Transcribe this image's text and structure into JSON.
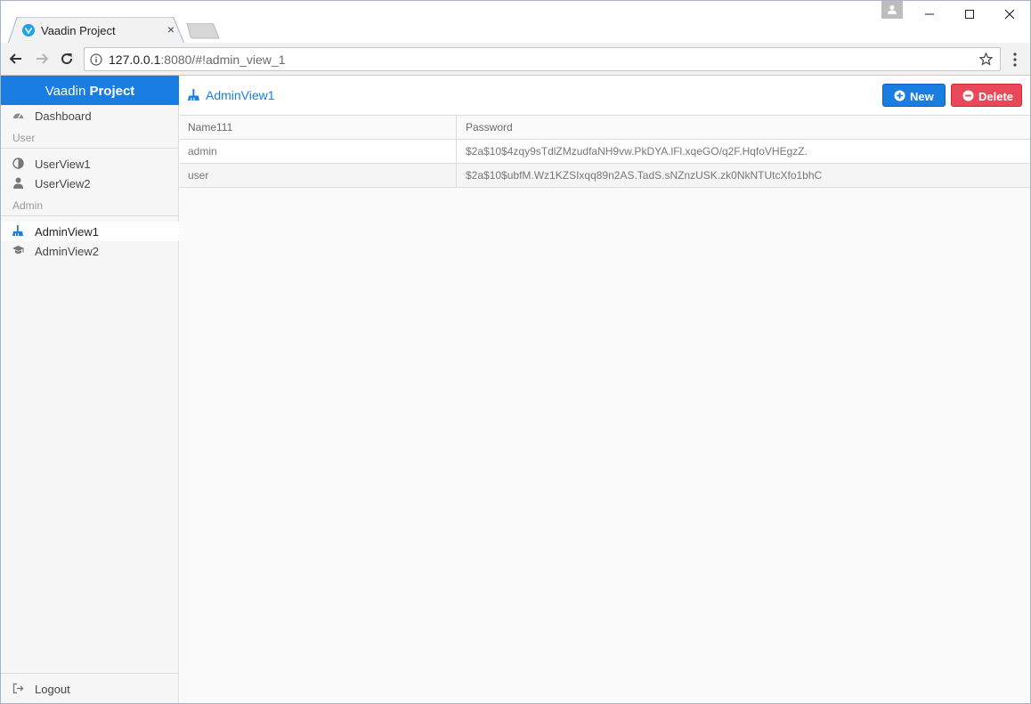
{
  "browser": {
    "tab_title": "Vaadin Project",
    "tab_close": "×",
    "url_host": "127.0.0.1",
    "url_rest": ":8080/#!admin_view_1"
  },
  "sidebar": {
    "brand_light": "Vaadin",
    "brand_bold": "Project",
    "items": [
      {
        "label": "Dashboard",
        "icon": "dashboard-icon"
      },
      {
        "label": "UserView1",
        "icon": "adjust-icon"
      },
      {
        "label": "UserView2",
        "icon": "user-icon"
      },
      {
        "label": "AdminView1",
        "icon": "broom-icon",
        "active": true
      },
      {
        "label": "AdminView2",
        "icon": "graduation-cap-icon"
      }
    ],
    "sections": [
      "User",
      "Admin"
    ],
    "logout_label": "Logout"
  },
  "view": {
    "title": "AdminView1",
    "new_label": "New",
    "delete_label": "Delete"
  },
  "grid": {
    "columns": [
      "Name111",
      "Password"
    ],
    "rows": [
      [
        "admin",
        "$2a$10$4zqy9sTdlZMzudfaNH9vw.PkDYA.lFl.xqeGO/q2F.HqfoVHEgzZ."
      ],
      [
        "user",
        "$2a$10$ubfM.Wz1KZSIxqq89n2AS.TadS.sNZnzUSK.zk0NkNTUtcXfo1bhC"
      ]
    ]
  },
  "colors": {
    "accent": "#197de1",
    "danger": "#e8485a"
  }
}
